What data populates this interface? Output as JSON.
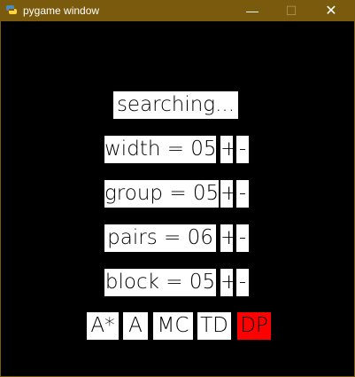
{
  "window": {
    "title": "pygame window",
    "min": "—",
    "max": "☐",
    "close": "✕"
  },
  "status": "searching...",
  "params": [
    {
      "label": "width = 05",
      "plus": "+",
      "minus": "-"
    },
    {
      "label": "group = 05",
      "plus": "+",
      "minus": "-"
    },
    {
      "label": "pairs = 06",
      "plus": "+",
      "minus": "-"
    },
    {
      "label": "block = 05",
      "plus": "+",
      "minus": "-"
    }
  ],
  "algorithms": [
    {
      "label": "A*"
    },
    {
      "label": "A"
    },
    {
      "label": "MC"
    },
    {
      "label": "TD"
    },
    {
      "label": "DP",
      "active": true
    }
  ],
  "colors": {
    "titlebar": "#7a5a0c",
    "background": "#000000",
    "button": "#ffffff",
    "active": "#ff0000"
  }
}
